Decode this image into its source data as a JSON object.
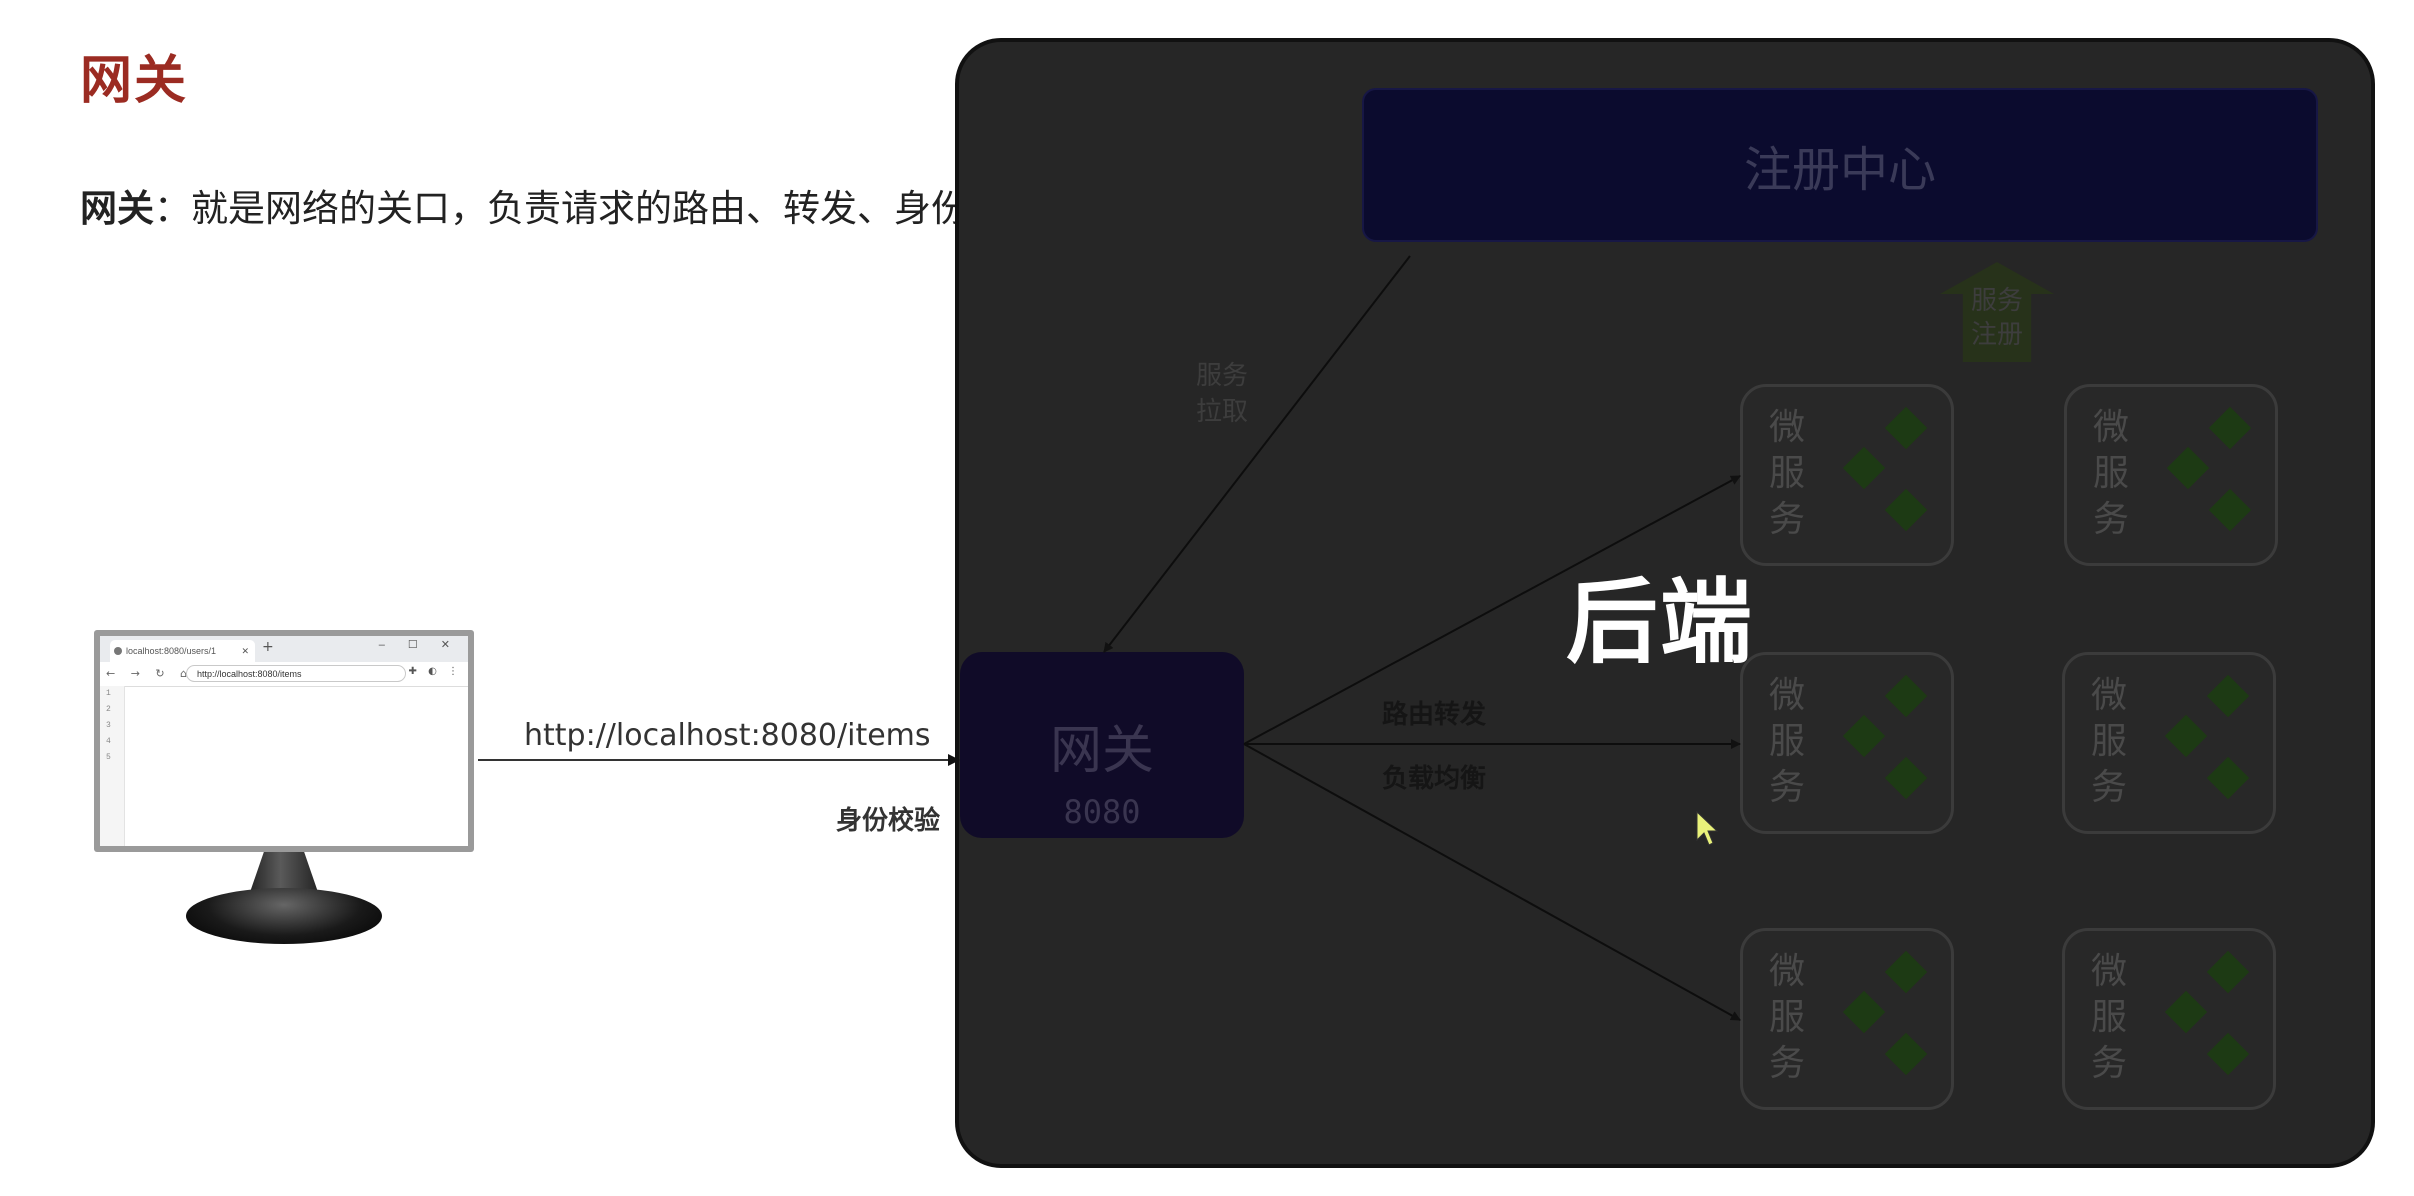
{
  "heading": "网关",
  "intro": {
    "term": "网关",
    "text": "：就是网络的关口，负责请求的路由、转发、身份校验。"
  },
  "browser": {
    "tab_title": "localhost:8080/users/1",
    "url": "http://localhost:8080/items",
    "line_numbers": [
      "1",
      "2",
      "3",
      "4",
      "5"
    ]
  },
  "client_request": {
    "url_label": "http://localhost:8080/items",
    "auth_label": "身份校验"
  },
  "backend": {
    "title": "后端",
    "registry_label": "注册中心",
    "gateway": {
      "name": "网关",
      "port": "8080"
    },
    "service_pull_label": [
      "服务",
      "拉取"
    ],
    "service_register_label": [
      "服务",
      "注册"
    ],
    "routing_label": "路由转发",
    "load_balance_label": "负载均衡",
    "microservice_label": [
      "微",
      "服",
      "务"
    ]
  },
  "colors": {
    "heading": "#9b2b22",
    "panel": "#262626",
    "registry": "#0b0b2e",
    "gateway": "#100b28",
    "gem": "#1d3a14",
    "cursor": "#e9f27a"
  }
}
